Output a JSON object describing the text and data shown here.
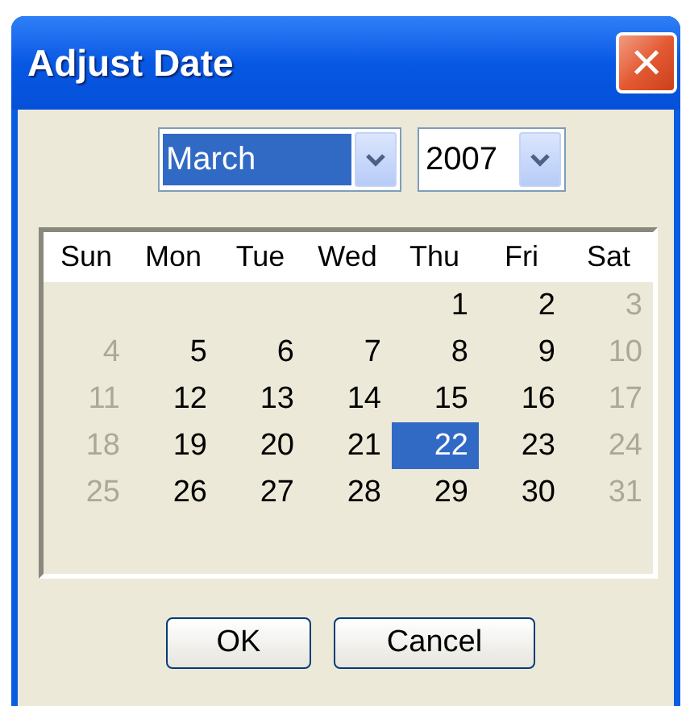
{
  "window": {
    "title": "Adjust Date",
    "close": "×"
  },
  "month_select": {
    "value": "March",
    "selected": true
  },
  "year_select": {
    "value": "2007",
    "selected": false
  },
  "calendar": {
    "weekdays": [
      "Sun",
      "Mon",
      "Tue",
      "Wed",
      "Thu",
      "Fri",
      "Sat"
    ],
    "weeks": [
      [
        {
          "day": "1",
          "muted": false,
          "selected": false
        },
        {
          "day": "2",
          "muted": false,
          "selected": false
        },
        {
          "day": "3",
          "muted": true,
          "selected": false
        }
      ],
      [
        {
          "day": "4",
          "muted": true,
          "selected": false
        },
        {
          "day": "5",
          "muted": false,
          "selected": false
        },
        {
          "day": "6",
          "muted": false,
          "selected": false
        },
        {
          "day": "7",
          "muted": false,
          "selected": false
        },
        {
          "day": "8",
          "muted": false,
          "selected": false
        },
        {
          "day": "9",
          "muted": false,
          "selected": false
        },
        {
          "day": "10",
          "muted": true,
          "selected": false
        }
      ],
      [
        {
          "day": "11",
          "muted": true,
          "selected": false
        },
        {
          "day": "12",
          "muted": false,
          "selected": false
        },
        {
          "day": "13",
          "muted": false,
          "selected": false
        },
        {
          "day": "14",
          "muted": false,
          "selected": false
        },
        {
          "day": "15",
          "muted": false,
          "selected": false
        },
        {
          "day": "16",
          "muted": false,
          "selected": false
        },
        {
          "day": "17",
          "muted": true,
          "selected": false
        }
      ],
      [
        {
          "day": "18",
          "muted": true,
          "selected": false
        },
        {
          "day": "19",
          "muted": false,
          "selected": false
        },
        {
          "day": "20",
          "muted": false,
          "selected": false
        },
        {
          "day": "21",
          "muted": false,
          "selected": false
        },
        {
          "day": "22",
          "muted": false,
          "selected": true
        },
        {
          "day": "23",
          "muted": false,
          "selected": false
        },
        {
          "day": "24",
          "muted": true,
          "selected": false
        }
      ],
      [
        {
          "day": "25",
          "muted": true,
          "selected": false
        },
        {
          "day": "26",
          "muted": false,
          "selected": false
        },
        {
          "day": "27",
          "muted": false,
          "selected": false
        },
        {
          "day": "28",
          "muted": false,
          "selected": false
        },
        {
          "day": "29",
          "muted": false,
          "selected": false
        },
        {
          "day": "30",
          "muted": false,
          "selected": false
        },
        {
          "day": "31",
          "muted": true,
          "selected": false
        }
      ]
    ]
  },
  "buttons": [
    "OK",
    "Cancel"
  ]
}
